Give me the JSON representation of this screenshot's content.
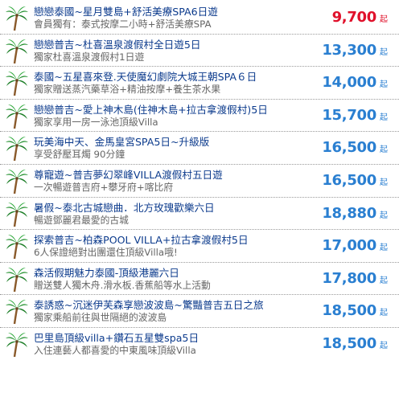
{
  "colors": {
    "title": "#0b3a8c",
    "subtitle": "#666666",
    "price": "#2a7fd1",
    "price_highlight": "#e0112b",
    "palm_leaf": "#1f8f2b",
    "palm_trunk": "#8a5a2b"
  },
  "icon": "palm-tree-icon",
  "items": [
    {
      "title": "戀戀泰國~星月雙島+舒活美療SPA6日遊",
      "subtitle": "會員獨有：泰式按摩二小時+舒活美療SPA",
      "price": "9,700",
      "unit": "起",
      "highlight": true
    },
    {
      "title": "戀戀普吉~杜喜溫泉渡假村全日遊5日",
      "subtitle": "獨家杜喜溫泉渡假村1日遊",
      "price": "13,300",
      "unit": "起",
      "highlight": false
    },
    {
      "title": "泰國~五星喜來登.天使魔幻劇院大城王朝SPA６日",
      "subtitle": "獨家贈送蒸汽藥草浴+精油按摩+養生茶水果",
      "price": "14,000",
      "unit": "起",
      "highlight": false
    },
    {
      "title": "戀戀普吉~愛上神木島(住神木島+拉古拿渡假村)5日",
      "subtitle": "獨家享用一房一泳池頂級Villa",
      "price": "15,700",
      "unit": "起",
      "highlight": false
    },
    {
      "title": "玩美海中天、金馬皇宮SPA5日~升級版",
      "subtitle": "享受舒壓耳燭 90分鐘",
      "price": "16,500",
      "unit": "起",
      "highlight": false
    },
    {
      "title": "尊寵遊~普吉夢幻翠峰VILLA渡假村五日遊",
      "subtitle": "一次暢遊普吉府+攀牙府+喀比府",
      "price": "16,500",
      "unit": "起",
      "highlight": false
    },
    {
      "title": "暑假~泰北古城戀曲．北方玫瑰歡樂六日",
      "subtitle": "暢遊鄧麗君最愛的古城",
      "price": "18,880",
      "unit": "起",
      "highlight": false
    },
    {
      "title": "探索普吉~柏森POOL VILLA+拉古拿渡假村5日",
      "subtitle": "6人保證絕對出團還住頂級Villa哦!",
      "price": "17,000",
      "unit": "起",
      "highlight": false
    },
    {
      "title": "森活假期魅力泰國-頂級港麗六日",
      "subtitle": "贈送雙人獨木舟.滑水板.香蕉船等水上活動",
      "price": "17,800",
      "unit": "起",
      "highlight": false
    },
    {
      "title": "泰誘惑~沉迷伊芙森享戀波波島~驚豔普吉五日之旅",
      "subtitle": "獨家乘船前往與世隔絕的波波島",
      "price": "18,500",
      "unit": "起",
      "highlight": false
    },
    {
      "title": "巴里島頂級villa+鑽石五星雙spa5日",
      "subtitle": "入住連藝人都喜愛的中東風味頂級Villa",
      "price": "18,500",
      "unit": "起",
      "highlight": false
    }
  ]
}
